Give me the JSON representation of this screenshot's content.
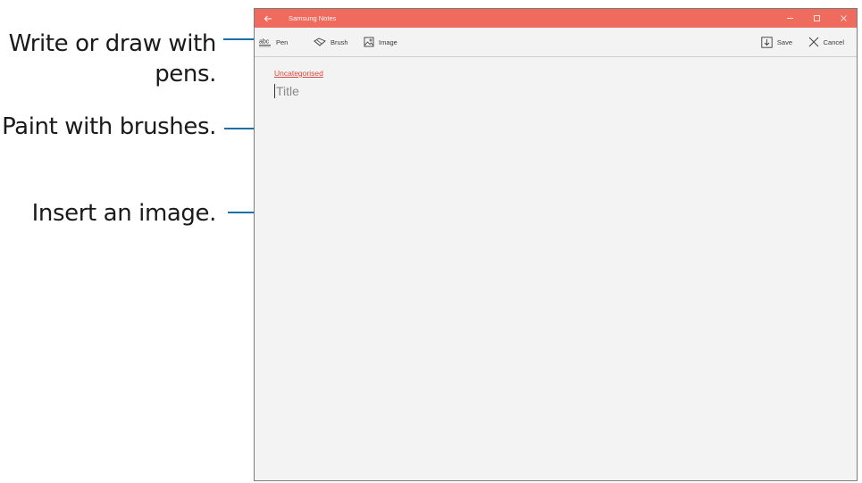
{
  "annotations": {
    "pen_line1": "Write or draw with",
    "pen_line2": "pens.",
    "brush": "Paint with brushes.",
    "image": "Insert an image."
  },
  "window": {
    "title": "Samsung Notes",
    "accent_color": "#ef6b5e"
  },
  "toolbar": {
    "pen_label": "Pen",
    "brush_label": "Brush",
    "image_label": "Image",
    "save_label": "Save",
    "cancel_label": "Cancel"
  },
  "note": {
    "category": "Uncategorised",
    "title_placeholder": "Title"
  },
  "colors": {
    "leader_line": "#1d6fa8",
    "link": "#d9473a"
  }
}
